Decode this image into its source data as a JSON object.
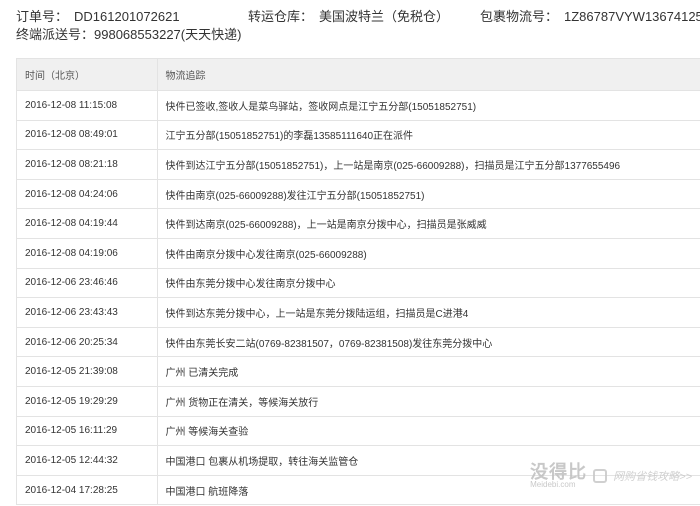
{
  "header": {
    "order_label": "订单号：",
    "order_no": "DD161201072621",
    "warehouse_label": "转运仓库：",
    "warehouse": "美国波特兰（免税仓）",
    "parcel_label": "包裹物流号：",
    "parcel_no": "1Z86787VYW13674125",
    "delivery_label": "终端派送号：",
    "delivery_no": "998068553227(天天快递)"
  },
  "table": {
    "columns": [
      "时间（北京）",
      "物流追踪"
    ],
    "rows": [
      {
        "time": "2016-12-08 11:15:08",
        "event": "快件已签收,签收人是菜鸟驿站，签收网点是江宁五分部(15051852751)"
      },
      {
        "time": "2016-12-08 08:49:01",
        "event": "江宁五分部(15051852751)的李磊13585111640正在派件"
      },
      {
        "time": "2016-12-08 08:21:18",
        "event": "快件到达江宁五分部(15051852751)，上一站是南京(025-66009288)，扫描员是江宁五分部1377655496"
      },
      {
        "time": "2016-12-08 04:24:06",
        "event": "快件由南京(025-66009288)发往江宁五分部(15051852751)"
      },
      {
        "time": "2016-12-08 04:19:44",
        "event": "快件到达南京(025-66009288)，上一站是南京分拨中心，扫描员是张威威"
      },
      {
        "time": "2016-12-08 04:19:06",
        "event": "快件由南京分拨中心发往南京(025-66009288)"
      },
      {
        "time": "2016-12-06 23:46:46",
        "event": "快件由东莞分拨中心发往南京分拨中心"
      },
      {
        "time": "2016-12-06 23:43:43",
        "event": "快件到达东莞分拨中心，上一站是东莞分拨陆运组，扫描员是C进港4"
      },
      {
        "time": "2016-12-06 20:25:34",
        "event": "快件由东莞长安二站(0769-82381507，0769-82381508)发往东莞分拨中心"
      },
      {
        "time": "2016-12-05 21:39:08",
        "event": "广州 已清关完成"
      },
      {
        "time": "2016-12-05 19:29:29",
        "event": "广州 货物正在清关，等候海关放行"
      },
      {
        "time": "2016-12-05 16:11:29",
        "event": "广州 等候海关查验"
      },
      {
        "time": "2016-12-05 12:44:32",
        "event": "中国港口 包裹从机场提取，转往海关监管仓"
      },
      {
        "time": "2016-12-04 17:28:25",
        "event": "中国港口 航班降落"
      }
    ]
  },
  "watermark": {
    "brand": "没得比",
    "domain": "Meidebi.com",
    "slogan": "网购省钱攻略>>",
    "icon": "bookmark-icon"
  }
}
